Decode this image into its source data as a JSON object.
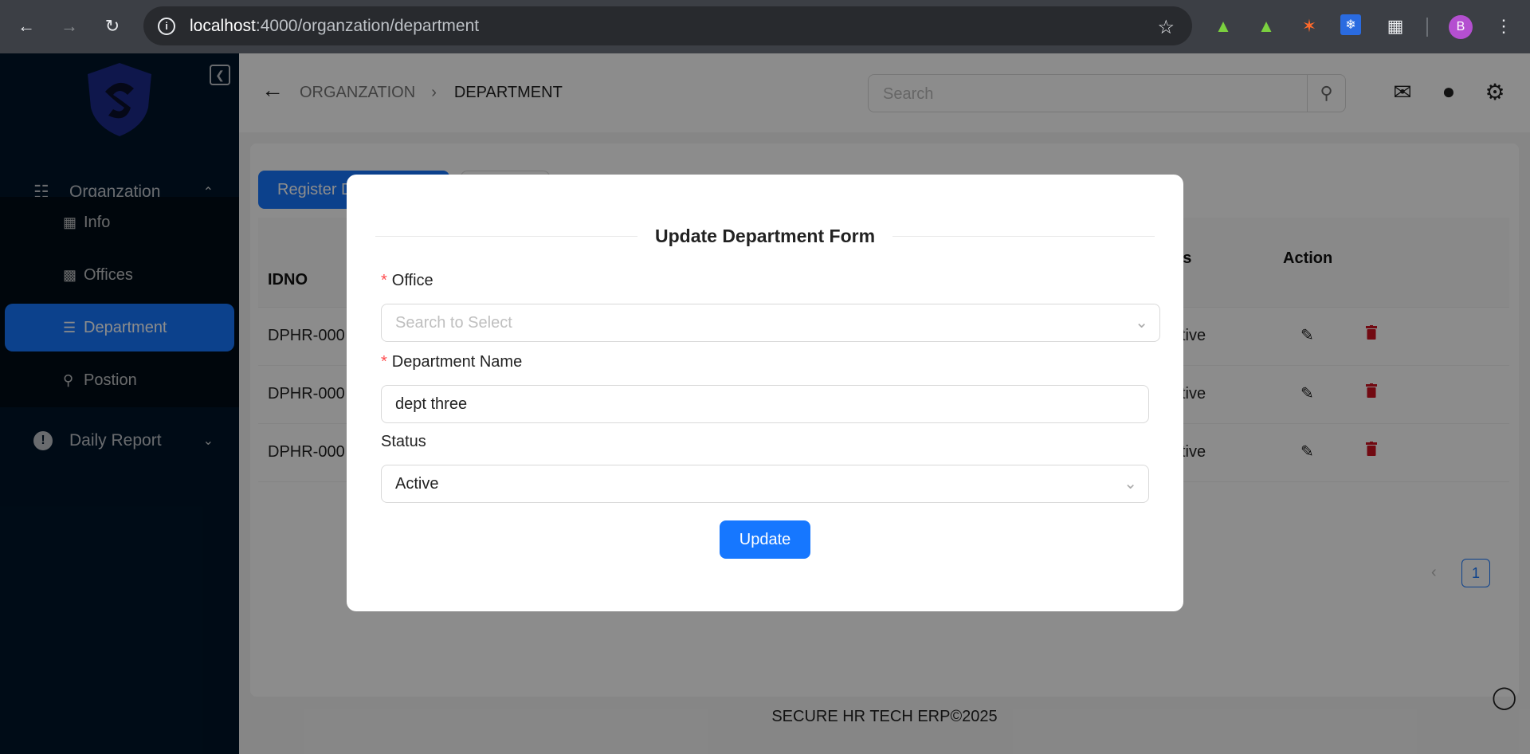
{
  "browser": {
    "url_host": "localhost",
    "url_path": ":4000/organzation/department",
    "profile_initial": "B"
  },
  "sidebar": {
    "organization_label": "Organzation",
    "items": [
      {
        "label": "Info",
        "icon": "building-icon"
      },
      {
        "label": "Offices",
        "icon": "office-icon"
      },
      {
        "label": "Department",
        "icon": "layers-icon",
        "active": true
      },
      {
        "label": "Postion",
        "icon": "chair-icon"
      }
    ],
    "daily_report_label": "Daily Report"
  },
  "header": {
    "breadcrumb_parent": "ORGANZATION",
    "breadcrumb_current": "DEPARTMENT",
    "search_placeholder": "Search"
  },
  "main": {
    "register_button_label": "Register Department",
    "columns": {
      "idno": "IDNO",
      "status_partial": "us",
      "action": "Action"
    },
    "rows": [
      {
        "idno_partial": "DPHR-000",
        "status_partial": "ctive"
      },
      {
        "idno_partial": "DPHR-000",
        "status_partial": "ctive"
      },
      {
        "idno_partial": "DPHR-000",
        "status_partial": "ctive"
      }
    ],
    "page_number": "1"
  },
  "footer": {
    "text": "SECURE HR TECH ERP©2025"
  },
  "modal": {
    "title": "Update Department Form",
    "office_label": "Office",
    "office_placeholder": "Search to Select",
    "department_name_label": "Department Name",
    "department_name_value": "dept three",
    "status_label": "Status",
    "status_value": "Active",
    "update_button_label": "Update"
  },
  "colors": {
    "primary": "#1677ff",
    "sidebar_bg": "#001529",
    "delete_red": "#cf1322"
  }
}
